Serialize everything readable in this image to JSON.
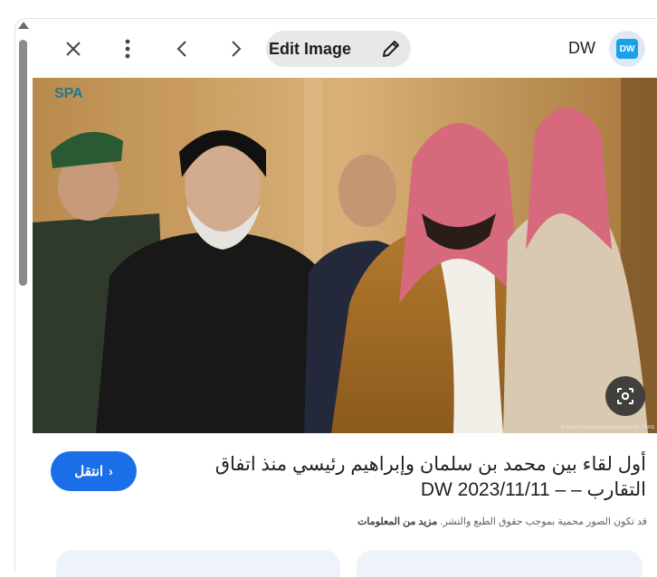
{
  "toolbar": {
    "edit_label": "Edit Image",
    "source_name": "DW",
    "source_logo_text": "DW"
  },
  "image": {
    "watermark": "SPA",
    "credit": "© Saudi Press Agency/Handout via REUTERS"
  },
  "result": {
    "title": "أول لقاء بين محمد بن سلمان وإبراهيم رئيسي منذ اتفاق التقارب – – DW 2023/11/11",
    "visit_label": "انتقل",
    "copyright_text": "قد تكون الصور محمية بموجب حقوق الطبع والنشر.",
    "more_info_label": "مزيد من المعلومات"
  },
  "colors": {
    "accent": "#1a6fe8",
    "pill": "#e8e8e8",
    "logo": "#1aa0e8"
  },
  "icons": [
    "close-icon",
    "more-vert-icon",
    "chevron-left-icon",
    "chevron-right-icon",
    "pencil-icon",
    "lens-icon"
  ]
}
